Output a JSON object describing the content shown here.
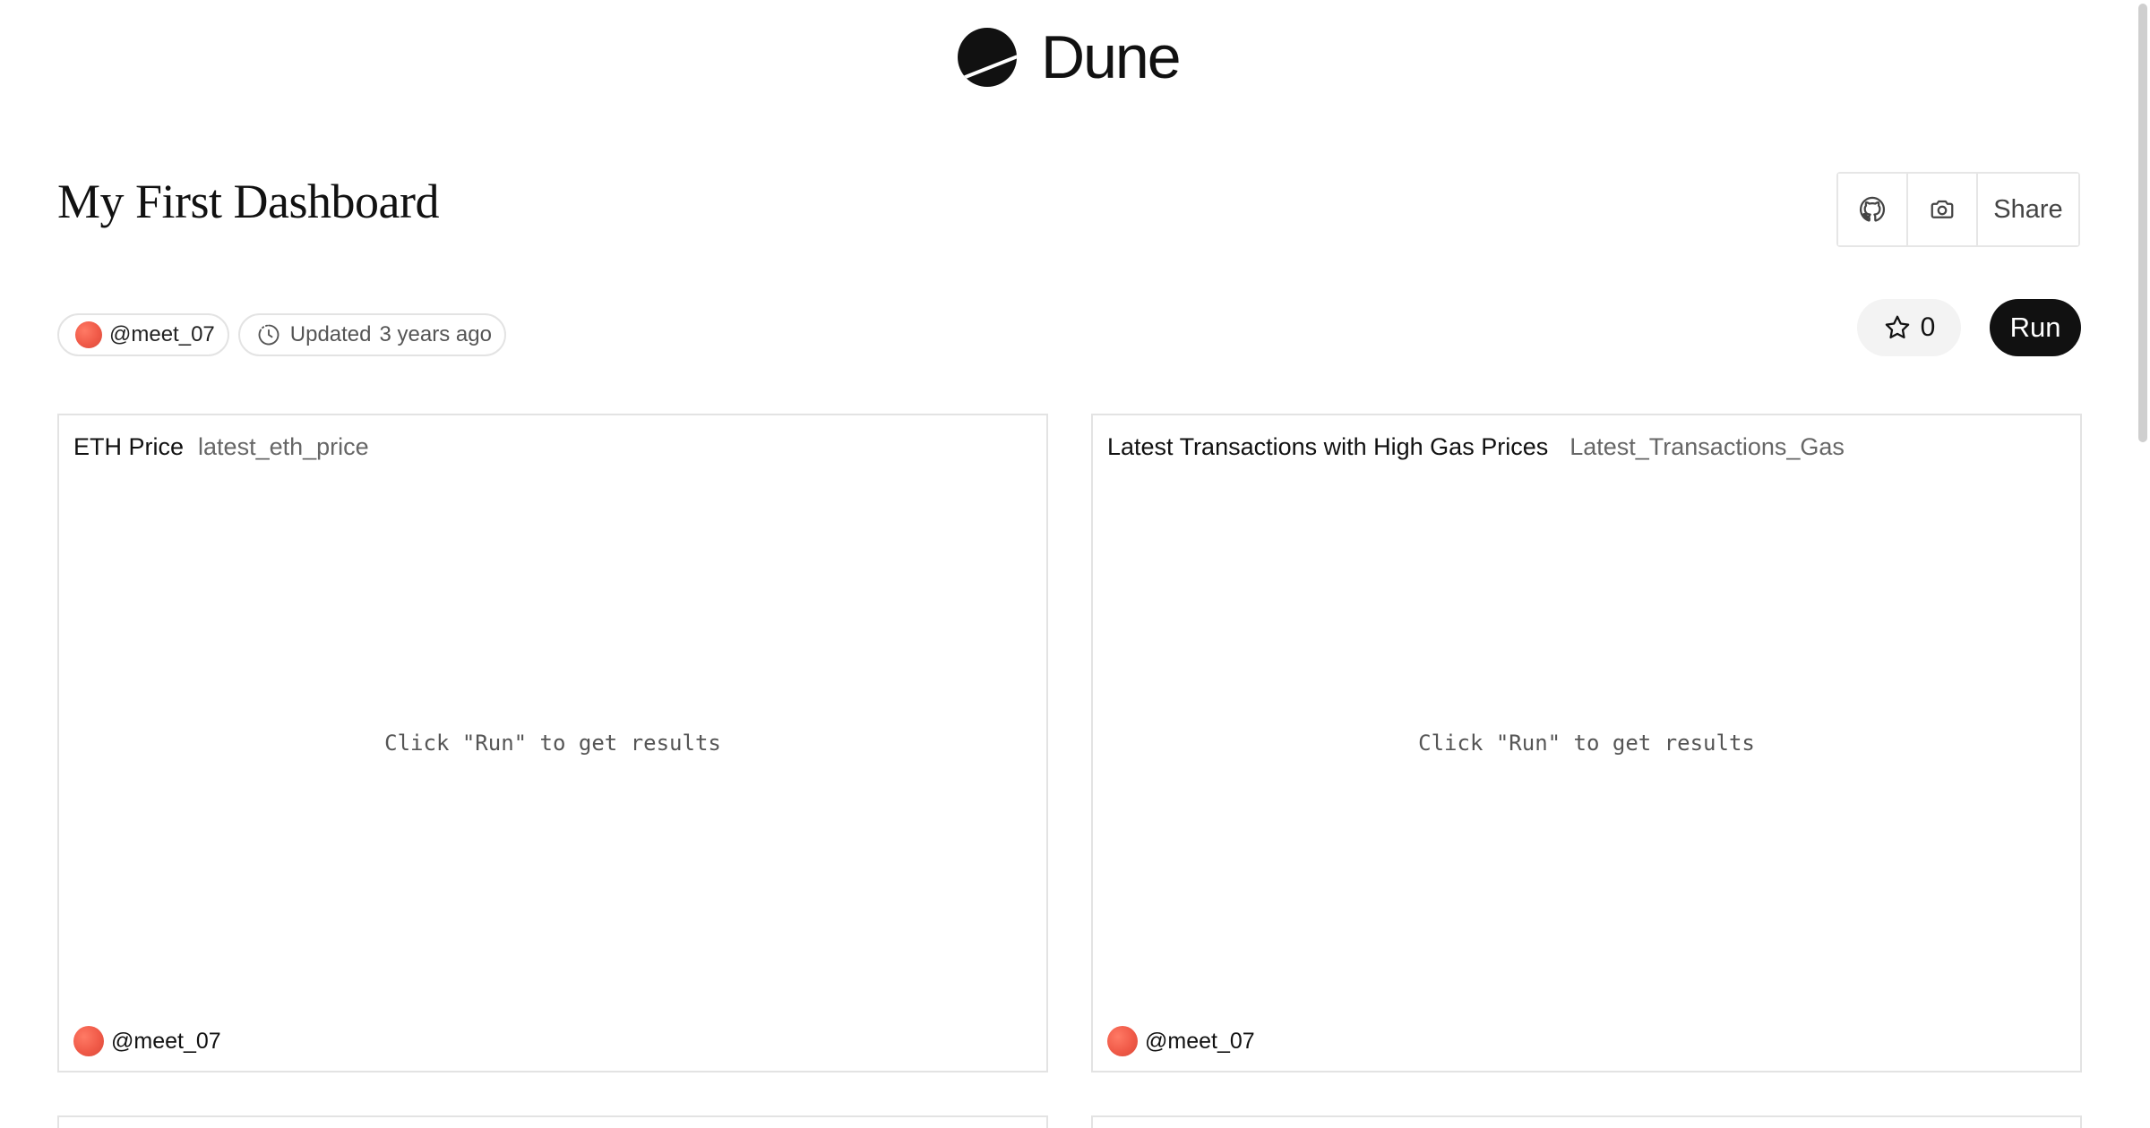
{
  "brand": {
    "name": "Dune",
    "logo_icon": "dune-logo-icon"
  },
  "dashboard": {
    "title": "My First Dashboard",
    "author": "@meet_07",
    "updated_label": "Updated",
    "updated_value": "3 years ago",
    "star_count": "0"
  },
  "actions": {
    "github_icon": "github-icon",
    "camera_icon": "camera-icon",
    "share_label": "Share",
    "run_label": "Run"
  },
  "cards": [
    {
      "title": "ETH Price",
      "subtitle": "latest_eth_price",
      "empty_message": "Click \"Run\" to get results",
      "author": "@meet_07"
    },
    {
      "title": "Latest Transactions with High Gas Prices",
      "subtitle": "Latest_Transactions_Gas",
      "empty_message": "Click \"Run\" to get results",
      "author": "@meet_07"
    }
  ],
  "colors": {
    "accent_dark": "#111111",
    "avatar": "#f05a48",
    "border": "#e3e3e3"
  }
}
